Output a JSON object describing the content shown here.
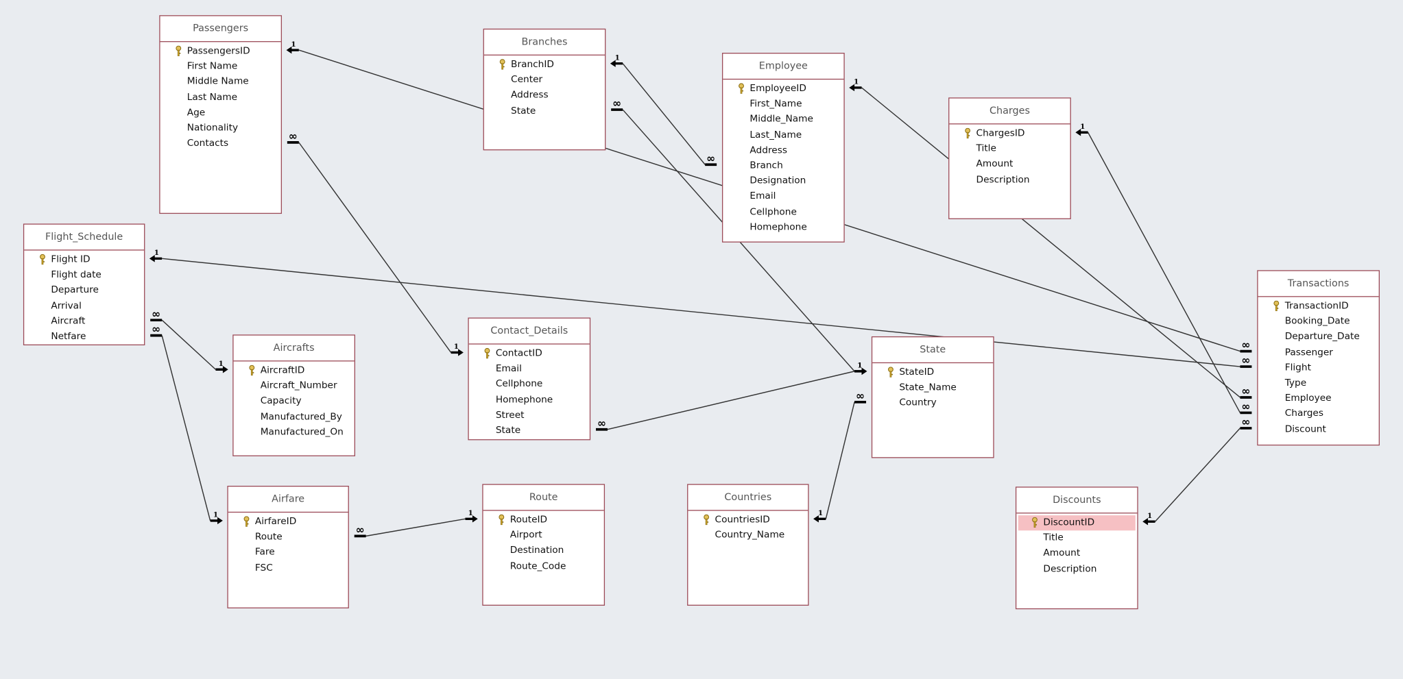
{
  "colors": {
    "background": "#e9ecf0",
    "table_border": "#9b4a57",
    "selected_field": "#f6c0c3",
    "key_icon": "#c9a227"
  },
  "tables": [
    {
      "name": "Passengers",
      "fields": [
        "PassengersID",
        "First Name",
        "Middle Name",
        "Last Name",
        "Age",
        "Nationality",
        "Contacts"
      ],
      "key": 0
    },
    {
      "name": "Branches",
      "fields": [
        "BranchID",
        "Center",
        "Address",
        "State"
      ],
      "key": 0
    },
    {
      "name": "Employee",
      "fields": [
        "EmployeeID",
        "First_Name",
        "Middle_Name",
        "Last_Name",
        "Address",
        "Branch",
        "Designation",
        "Email",
        "Cellphone",
        "Homephone"
      ],
      "key": 0
    },
    {
      "name": "Charges",
      "fields": [
        "ChargesID",
        "Title",
        "Amount",
        "Description"
      ],
      "key": 0
    },
    {
      "name": "Flight_Schedule",
      "fields": [
        "Flight ID",
        "Flight date",
        "Departure",
        "Arrival",
        "Aircraft",
        "Netfare"
      ],
      "key": 0
    },
    {
      "name": "Aircrafts",
      "fields": [
        "AircraftID",
        "Aircraft_Number",
        "Capacity",
        "Manufactured_By",
        "Manufactured_On"
      ],
      "key": 0
    },
    {
      "name": "Contact_Details",
      "fields": [
        "ContactID",
        "Email",
        "Cellphone",
        "Homephone",
        "Street",
        "State"
      ],
      "key": 0
    },
    {
      "name": "State",
      "fields": [
        "StateID",
        "State_Name",
        "Country"
      ],
      "key": 0
    },
    {
      "name": "Transactions",
      "fields": [
        "TransactionID",
        "Booking_Date",
        "Departure_Date",
        "Passenger",
        "Flight",
        "Type",
        "Employee",
        "Charges",
        "Discount"
      ],
      "key": 0
    },
    {
      "name": "Airfare",
      "fields": [
        "AirfareID",
        "Route",
        "Fare",
        "FSC"
      ],
      "key": 0
    },
    {
      "name": "Route",
      "fields": [
        "RouteID",
        "Airport",
        "Destination",
        "Route_Code"
      ],
      "key": 0
    },
    {
      "name": "Countries",
      "fields": [
        "CountriesID",
        "Country_Name"
      ],
      "key": 0
    },
    {
      "name": "Discounts",
      "fields": [
        "DiscountID",
        "Title",
        "Amount",
        "Description"
      ],
      "key": 0,
      "selected_field": 0
    }
  ],
  "relationships": [
    {
      "one": {
        "table": "Passengers",
        "field": "PassengersID",
        "label": "1"
      },
      "many": {
        "table": "Transactions",
        "field": "Passenger",
        "label": "∞"
      }
    },
    {
      "one": {
        "table": "Branches",
        "field": "BranchID",
        "label": "1"
      },
      "many": {
        "table": "Employee",
        "field": "Branch",
        "label": "∞"
      }
    },
    {
      "one": {
        "table": "State",
        "field": "StateID",
        "label": "1"
      },
      "many": {
        "table": "Branches",
        "field": "State",
        "label": "∞"
      }
    },
    {
      "one": {
        "table": "Employee",
        "field": "EmployeeID",
        "label": "1"
      },
      "many": {
        "table": "Transactions",
        "field": "Employee",
        "label": "∞"
      }
    },
    {
      "one": {
        "table": "Charges",
        "field": "ChargesID",
        "label": "1"
      },
      "many": {
        "table": "Transactions",
        "field": "Charges",
        "label": "∞"
      }
    },
    {
      "one": {
        "table": "Flight_Schedule",
        "field": "Flight ID",
        "label": "1"
      },
      "many": {
        "table": "Transactions",
        "field": "Flight",
        "label": "∞"
      }
    },
    {
      "one": {
        "table": "Aircrafts",
        "field": "AircraftID",
        "label": "1"
      },
      "many": {
        "table": "Flight_Schedule",
        "field": "Aircraft",
        "label": "∞"
      }
    },
    {
      "one": {
        "table": "Airfare",
        "field": "AirfareID",
        "label": "1"
      },
      "many": {
        "table": "Flight_Schedule",
        "field": "Netfare",
        "label": "∞"
      }
    },
    {
      "one": {
        "table": "Contact_Details",
        "field": "ContactID",
        "label": "1"
      },
      "many": {
        "table": "Passengers",
        "field": "Contacts",
        "label": "∞"
      }
    },
    {
      "one": {
        "table": "State",
        "field": "StateID",
        "label": "1"
      },
      "many": {
        "table": "Contact_Details",
        "field": "State",
        "label": "∞"
      }
    },
    {
      "one": {
        "table": "Route",
        "field": "RouteID",
        "label": "1"
      },
      "many": {
        "table": "Airfare",
        "field": "Route",
        "label": "∞"
      }
    },
    {
      "one": {
        "table": "Countries",
        "field": "CountriesID",
        "label": "1"
      },
      "many": {
        "table": "State",
        "field": "Country",
        "label": "∞"
      }
    },
    {
      "one": {
        "table": "Discounts",
        "field": "DiscountID",
        "label": "1"
      },
      "many": {
        "table": "Transactions",
        "field": "Discount",
        "label": "∞"
      }
    }
  ]
}
